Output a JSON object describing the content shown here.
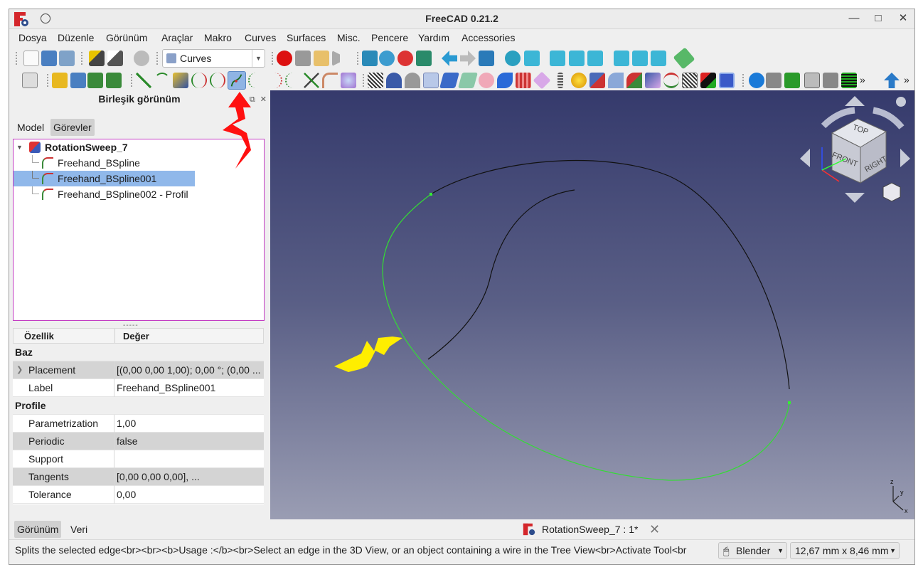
{
  "window": {
    "title": "FreeCAD 0.21.2"
  },
  "menu": [
    "Dosya",
    "Düzenle",
    "Görünüm",
    "Araçlar",
    "Makro",
    "Curves",
    "Surfaces",
    "Misc.",
    "Pencere",
    "Yardım",
    "Accessories"
  ],
  "toolbar": {
    "workbench_combo": "Curves",
    "overflow": "»"
  },
  "left_panel": {
    "title": "Birleşik görünüm",
    "tabs": [
      "Model",
      "Görevler"
    ],
    "tree": {
      "root": "RotationSweep_7",
      "children": [
        "Freehand_BSpline",
        "Freehand_BSpline001",
        "Freehand_BSpline002 - Profil"
      ],
      "selected_index": 1
    },
    "splitter_mark": "-----",
    "properties": {
      "headers": [
        "Özellik",
        "Değer"
      ],
      "groups": [
        {
          "name": "Baz",
          "rows": [
            {
              "key": "Placement",
              "value": "[(0,00 0,00 1,00); 0,00 °; (0,00 ..."
            },
            {
              "key": "Label",
              "value": "Freehand_BSpline001"
            }
          ]
        },
        {
          "name": "Profile",
          "rows": [
            {
              "key": "Parametrization",
              "value": "1,00"
            },
            {
              "key": "Periodic",
              "value": "false"
            },
            {
              "key": "Support",
              "value": ""
            },
            {
              "key": "Tangents",
              "value": "[0,00 0,00 0,00], ..."
            },
            {
              "key": "Tolerance",
              "value": "0,00"
            }
          ]
        }
      ]
    },
    "bottom_tabs": [
      "Görünüm",
      "Veri"
    ]
  },
  "navcube": {
    "faces": [
      "TOP",
      "FRONT",
      "RIGHT"
    ]
  },
  "axes": {
    "x": "x",
    "y": "y",
    "z": "z"
  },
  "document_tab": "RotationSweep_7 : 1*",
  "statusbar": {
    "message": "Splits the selected edge<br><br><b>Usage :</b><br>Select an edge in the 3D View, or an object containing a wire in the Tree View<br>Activate Tool<br",
    "nav_style": "Blender",
    "dimensions": "12,67 mm x 8,46 mm"
  },
  "colors": {
    "selection_blue": "#90b8ea",
    "tree_border": "#c33cc3",
    "curve_green": "#33dd33",
    "annotation_red": "#ff1010",
    "annotation_yellow": "#ffee00"
  }
}
